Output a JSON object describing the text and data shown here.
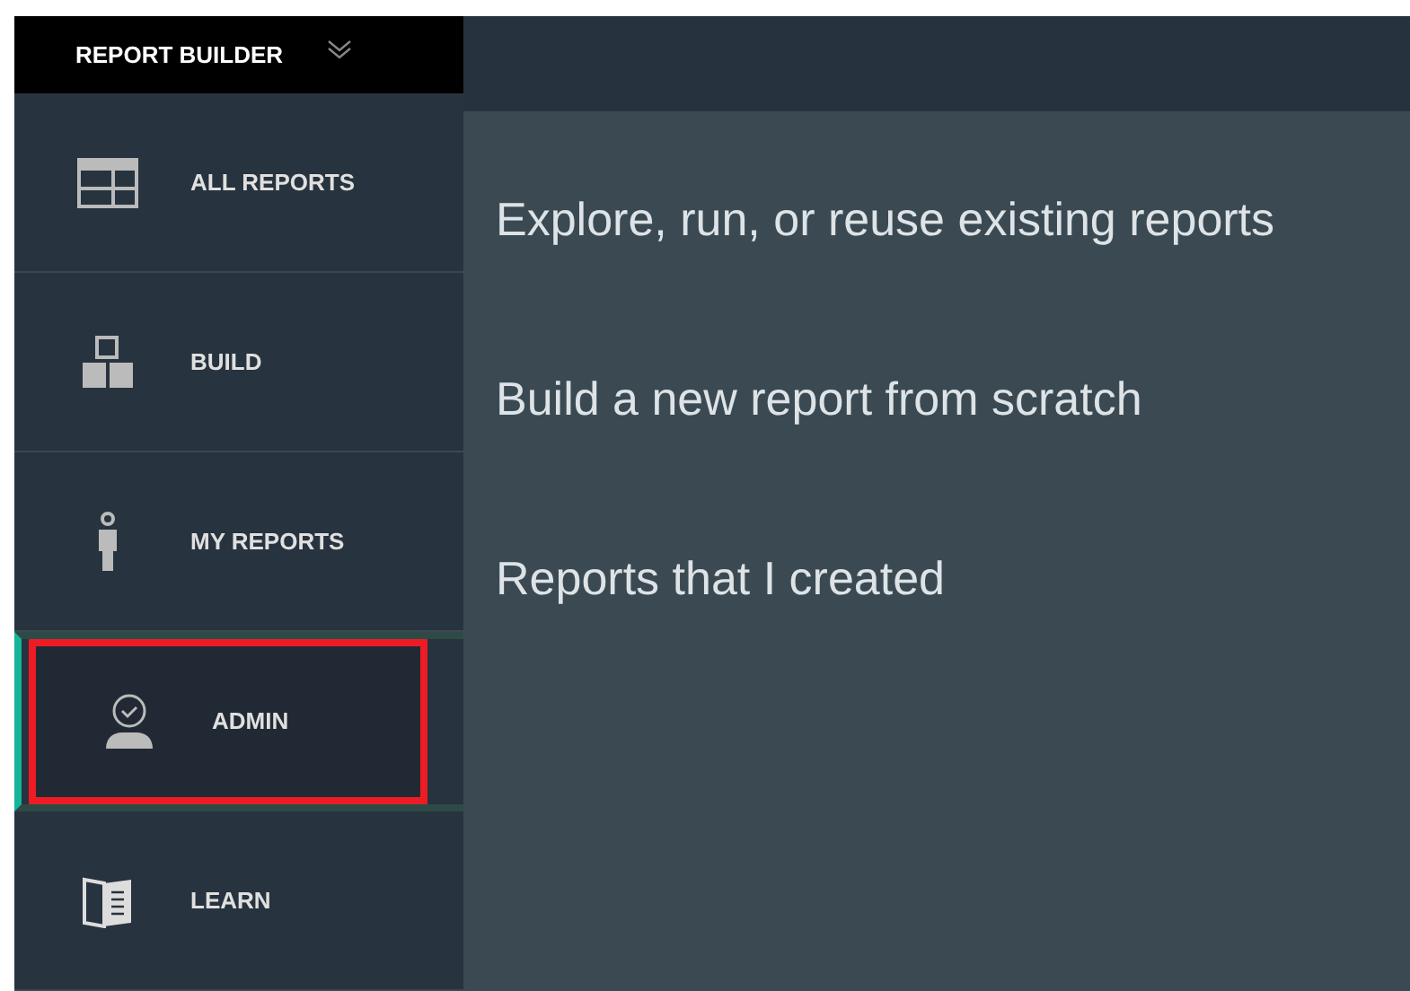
{
  "sidebar": {
    "title": "REPORT BUILDER",
    "items": [
      {
        "label": "ALL REPORTS",
        "selected": false,
        "highlighted": false
      },
      {
        "label": "BUILD",
        "selected": false,
        "highlighted": false
      },
      {
        "label": "MY REPORTS",
        "selected": false,
        "highlighted": false
      },
      {
        "label": "ADMIN",
        "selected": true,
        "highlighted": true
      },
      {
        "label": "LEARN",
        "selected": false,
        "highlighted": false
      }
    ]
  },
  "descriptions": [
    "Explore, run, or reuse existing reports",
    "Build a new report from scratch",
    "Reports that I created"
  ]
}
